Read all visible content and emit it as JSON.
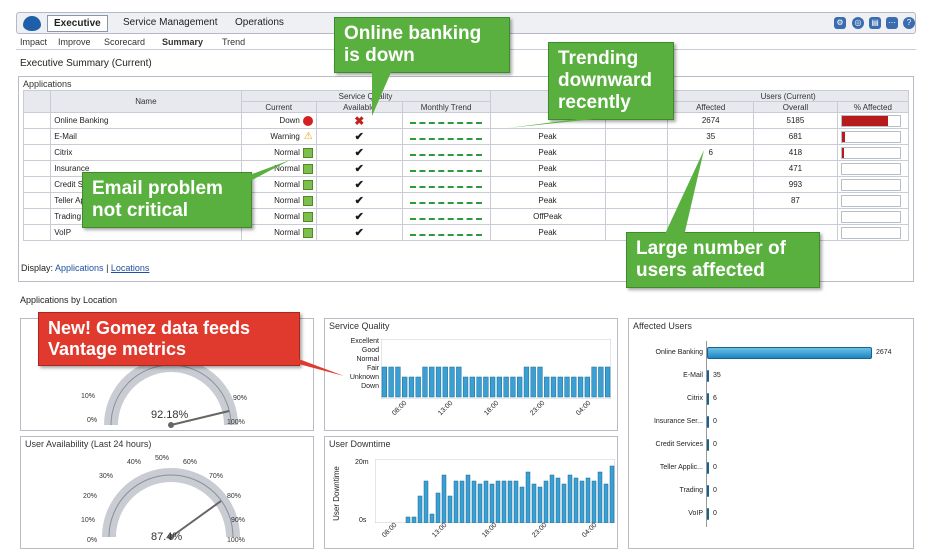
{
  "tabs": {
    "items": [
      "Executive",
      "Service Management",
      "Operations"
    ]
  },
  "subnav": [
    "Impact",
    "Improve",
    "Scorecard",
    "Summary",
    "Trend"
  ],
  "page_title": "Executive Summary (Current)",
  "apps": {
    "title": "Applications",
    "col_name": "Name",
    "group_sq": "Service Quality",
    "group_users": "Users (Current)",
    "cols": [
      "Current",
      "Available",
      "Monthly Trend",
      "Affected",
      "Overall",
      "% Affected"
    ],
    "rows": [
      {
        "name": "Online Banking",
        "status": "Down",
        "avail": "x",
        "peak": "",
        "affected": "2674",
        "overall": "5185",
        "pct": 80
      },
      {
        "name": "E-Mail",
        "status": "Warning",
        "avail": "v",
        "peak": "Peak",
        "affected": "35",
        "overall": "681",
        "pct": 5
      },
      {
        "name": "Citrix",
        "status": "Normal",
        "avail": "v",
        "peak": "Peak",
        "affected": "6",
        "overall": "418",
        "pct": 2
      },
      {
        "name": "Insurance",
        "status": "Normal",
        "avail": "v",
        "peak": "Peak",
        "affected": "",
        "overall": "471",
        "pct": 0
      },
      {
        "name": "Credit Se",
        "status": "Normal",
        "avail": "v",
        "peak": "Peak",
        "affected": "",
        "overall": "993",
        "pct": 0
      },
      {
        "name": "Teller Ap",
        "status": "Normal",
        "avail": "v",
        "peak": "Peak",
        "affected": "",
        "overall": "87",
        "pct": 0
      },
      {
        "name": "Trading",
        "status": "Normal",
        "avail": "v",
        "peak": "OffPeak",
        "affected": "",
        "overall": "",
        "pct": 0
      },
      {
        "name": "VoIP",
        "status": "Normal",
        "avail": "v",
        "peak": "Peak",
        "affected": "",
        "overall": "",
        "pct": 0
      }
    ],
    "display_label": "Display:",
    "display_links": [
      "Applications",
      "Locations"
    ]
  },
  "by_location": "Applications by Location",
  "panels": {
    "sq_title": "Service Quality",
    "sq_ylabels": [
      "Excellent",
      "Good",
      "Normal",
      "Fair",
      "Unknown",
      "Down"
    ],
    "sq_xlabels": [
      "08:00",
      "13:00",
      "18:00",
      "23:00",
      "04:00"
    ],
    "au_title": "Affected Users",
    "avail_title": "User Availability (Last 24 hours)",
    "downtime_title": "User Downtime",
    "downtime_ylabel": "User Downtime",
    "downtime_yticks": [
      "20m",
      "0s"
    ],
    "downtime_xlabels": [
      "08:00",
      "13:00",
      "18:00",
      "23:00",
      "04:00"
    ],
    "gauge1_value": "92.18%",
    "gauge2_value": "87.4%",
    "gauge_labels": [
      "0%",
      "10%",
      "20%",
      "30%",
      "40%",
      "50%",
      "60%",
      "70%",
      "80%",
      "90%",
      "100%"
    ]
  },
  "callouts": {
    "c1": "Online banking is down",
    "c2": "Trending downward recently",
    "c3": "Email problem not critical",
    "c4": "Large number of users affected",
    "c5": "New! Gomez data feeds Vantage metrics"
  },
  "chart_data": [
    {
      "type": "bar",
      "title": "Affected Users",
      "categories": [
        "Online Banking",
        "E-Mail",
        "Citrix",
        "Insurance Ser...",
        "Credit Services",
        "Teller Applic...",
        "Trading",
        "VoIP"
      ],
      "values": [
        2674,
        35,
        6,
        0,
        0,
        0,
        0,
        0
      ]
    },
    {
      "type": "bar",
      "title": "User Downtime",
      "ylabel": "User Downtime",
      "values": [
        0,
        0,
        0,
        0,
        0,
        2,
        2,
        9,
        14,
        3,
        10,
        16,
        9,
        14,
        14,
        16,
        14,
        13,
        14,
        13,
        14,
        14,
        14,
        14,
        12,
        17,
        13,
        12,
        14,
        16,
        15,
        13,
        16,
        15,
        14,
        15,
        14,
        17,
        13,
        19
      ]
    },
    {
      "type": "bar",
      "title": "Service Quality",
      "values": [
        3,
        3,
        3,
        2,
        2,
        2,
        3,
        3,
        3,
        3,
        3,
        3,
        2,
        2,
        2,
        2,
        2,
        2,
        2,
        2,
        2,
        3,
        3,
        3,
        2,
        2,
        2,
        2,
        2,
        2,
        2,
        3,
        3,
        3
      ]
    }
  ],
  "colors": {
    "accent": "#1d5fa8",
    "bar": "#3aa0d4",
    "down": "#b81b1b",
    "green_callout": "#5ab03f",
    "red_callout": "#e03a2f"
  }
}
